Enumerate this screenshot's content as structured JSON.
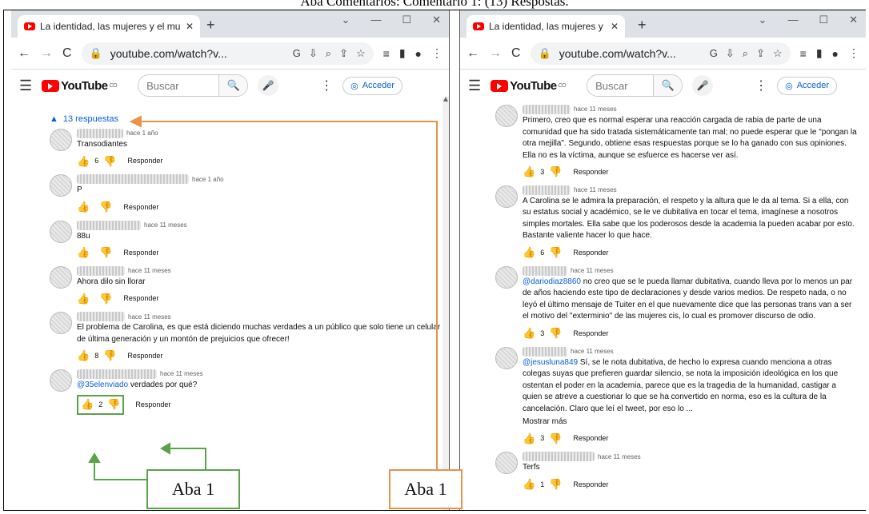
{
  "caption": "Aba Comentários: Comentário 1: (13) Respostas.",
  "window_controls": [
    "⌄",
    "—",
    "☐",
    "✕"
  ],
  "left": {
    "tab_title": "La identidad, las mujeres y el mu",
    "url": "youtube.com/watch?v...",
    "search_placeholder": "Buscar",
    "signin": "Acceder",
    "replies_label": "13 respuestas",
    "comments": [
      {
        "time": "hace 1 año",
        "text": "Transodiantes",
        "likes": "6",
        "mention": "",
        "blur_w": 58
      },
      {
        "time": "hace 1 año",
        "text": "P",
        "likes": "",
        "mention": "",
        "blur_w": 140
      },
      {
        "time": "hace 11 meses",
        "text": "88u",
        "likes": "",
        "mention": "",
        "blur_w": 80
      },
      {
        "time": "hace 11 meses",
        "text": "Ahora dilo sin llorar",
        "likes": "",
        "mention": "",
        "blur_w": 60
      },
      {
        "time": "hace 11 meses",
        "text": "El problema de Carolina, es que está diciendo muchas verdades a un público que solo tiene un celular de última generación y un montón de prejuicios que ofrecer!",
        "likes": "8",
        "mention": "",
        "blur_w": 60
      },
      {
        "time": "hace 11 meses",
        "text": "verdades por qué?",
        "likes": "2",
        "mention": "@35elenviado",
        "blur_w": 100
      }
    ],
    "reply_label": "Responder"
  },
  "right": {
    "tab_title": "La identidad, las mujeres y el mu",
    "url": "youtube.com/watch?v...",
    "search_placeholder": "Buscar",
    "signin": "Acceder",
    "comments": [
      {
        "time": "hace 11 meses",
        "text": "Primero, creo que es normal esperar una reacción cargada de rabia de parte de una comunidad que ha sido tratada sistemáticamente tan mal; no puede esperar que le \"pongan la otra mejilla\". Segundo, obtiene esas respuestas porque se lo ha ganado con sus opiniones. Ella no es la víctima, aunque se esfuerce es hacerse ver así.",
        "likes": "3",
        "mention": "",
        "blur_w": 60
      },
      {
        "time": "hace 11 meses",
        "text": "A Carolina se le admira la preparación, el respeto y la altura que le da al tema. Si a ella, con su estatus social y académico, se le ve dubitativa en tocar el tema, imagínese a nosotros simples mortales. Ella sabe que los poderosos desde la academia la pueden acabar por esto. Bastante valiente hacer lo que hace.",
        "likes": "6",
        "mention": "",
        "blur_w": 60
      },
      {
        "time": "hace 11 meses",
        "text": "no creo que se le pueda llamar dubitativa, cuando lleva por lo menos un par de años haciendo este tipo de declaraciones y desde varios medios. De respeto nada, o no leyó el último mensaje de Tuiter en el que nuevamente dice que las personas trans van a ser el motivo del \"exterminio\" de las mujeres cis, lo cual es promover discurso de odio.",
        "likes": "3",
        "mention": "@dariodiaz8860",
        "blur_w": 56
      },
      {
        "time": "hace 11 meses",
        "text": "Sí, se le nota dubitativa, de hecho lo expresa cuando menciona a otras colegas suyas que prefieren guardar silencio, se nota la imposición ideológica en los que ostentan el poder en la academia, parece que es la tragedia de la humanidad, castigar a quien se atreve a cuestionar lo que se ha convertido en norma, eso es la cultura de la cancelación. Claro que leí el tweet, por eso lo ...",
        "likes": "3",
        "mention": "@jesusluna849",
        "blur_w": 56,
        "more": "Mostrar más"
      },
      {
        "time": "hace 11 meses",
        "text": "Terfs",
        "likes": "1",
        "mention": "",
        "blur_w": 90
      }
    ],
    "reply_label": "Responder"
  },
  "annotations": {
    "green_label": "Aba 1",
    "orange_label": "Aba 1",
    "green_color": "#5aa34a",
    "orange_color": "#e8924a"
  }
}
